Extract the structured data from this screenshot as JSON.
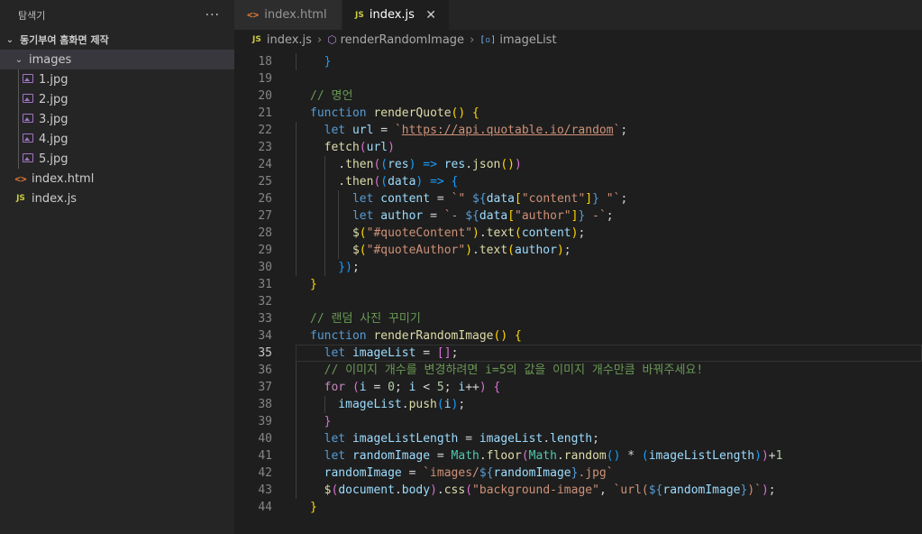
{
  "sidebar": {
    "title": "탐색기",
    "more_label": "···",
    "project_name": "동기부여 홈화면 제작",
    "folder_images": "images",
    "files_images": [
      "1.jpg",
      "2.jpg",
      "3.jpg",
      "4.jpg",
      "5.jpg"
    ],
    "file_html": "index.html",
    "file_js": "index.js"
  },
  "tabs": [
    {
      "label": "index.html",
      "icon": "html-icon",
      "active": false
    },
    {
      "label": "index.js",
      "icon": "js-icon",
      "active": true
    }
  ],
  "tab_close": "✕",
  "icons": {
    "js_label": "JS",
    "html_glyph": "<>"
  },
  "breadcrumb": {
    "file": "index.js",
    "function": "renderRandomImage",
    "symbol": "imageList"
  },
  "editor": {
    "first_line": 18,
    "current_line": 35,
    "lines": [
      [
        [
          "  }",
          "br3"
        ]
      ],
      [],
      [
        [
          "// 명언",
          "cmt"
        ]
      ],
      [
        [
          "function ",
          "kw"
        ],
        [
          "renderQuote",
          "fn"
        ],
        [
          "() {",
          "br1"
        ]
      ],
      [
        [
          "  let ",
          "kw"
        ],
        [
          "url",
          "var"
        ],
        [
          " = ",
          "pun"
        ],
        [
          "`",
          "str"
        ],
        [
          "https://api.quotable.io/random",
          "str url"
        ],
        [
          "`",
          "str"
        ],
        [
          ";",
          "pun"
        ]
      ],
      [
        [
          "  fetch",
          "fn"
        ],
        [
          "(",
          "br2"
        ],
        [
          "url",
          "var"
        ],
        [
          ")",
          "br2"
        ]
      ],
      [
        [
          "    .",
          "pun"
        ],
        [
          "then",
          "fn"
        ],
        [
          "(",
          "br2"
        ],
        [
          "(",
          "br3"
        ],
        [
          "res",
          "var"
        ],
        [
          ") => ",
          "br3"
        ],
        [
          "res",
          "var"
        ],
        [
          ".",
          "pun"
        ],
        [
          "json",
          "fn"
        ],
        [
          "()",
          "br1"
        ],
        [
          ")",
          "br2"
        ]
      ],
      [
        [
          "    .",
          "pun"
        ],
        [
          "then",
          "fn"
        ],
        [
          "(",
          "br2"
        ],
        [
          "(",
          "br3"
        ],
        [
          "data",
          "var"
        ],
        [
          ") => {",
          "br3"
        ]
      ],
      [
        [
          "      let ",
          "kw"
        ],
        [
          "content",
          "var"
        ],
        [
          " = ",
          "pun"
        ],
        [
          "`\" ",
          "str"
        ],
        [
          "${",
          "kw"
        ],
        [
          "data",
          "var"
        ],
        [
          "[",
          "br1"
        ],
        [
          "\"content\"",
          "str"
        ],
        [
          "]",
          "br1"
        ],
        [
          "}",
          "kw"
        ],
        [
          " \"`",
          "str"
        ],
        [
          ";",
          "pun"
        ]
      ],
      [
        [
          "      let ",
          "kw"
        ],
        [
          "author",
          "var"
        ],
        [
          " = ",
          "pun"
        ],
        [
          "`- ",
          "str"
        ],
        [
          "${",
          "kw"
        ],
        [
          "data",
          "var"
        ],
        [
          "[",
          "br1"
        ],
        [
          "\"author\"",
          "str"
        ],
        [
          "]",
          "br1"
        ],
        [
          "}",
          "kw"
        ],
        [
          " -`",
          "str"
        ],
        [
          ";",
          "pun"
        ]
      ],
      [
        [
          "      $",
          "fn"
        ],
        [
          "(",
          "br1"
        ],
        [
          "\"#quoteContent\"",
          "str"
        ],
        [
          ")",
          "br1"
        ],
        [
          ".",
          "pun"
        ],
        [
          "text",
          "fn"
        ],
        [
          "(",
          "br1"
        ],
        [
          "content",
          "var"
        ],
        [
          ")",
          "br1"
        ],
        [
          ";",
          "pun"
        ]
      ],
      [
        [
          "      $",
          "fn"
        ],
        [
          "(",
          "br1"
        ],
        [
          "\"#quoteAuthor\"",
          "str"
        ],
        [
          ")",
          "br1"
        ],
        [
          ".",
          "pun"
        ],
        [
          "text",
          "fn"
        ],
        [
          "(",
          "br1"
        ],
        [
          "author",
          "var"
        ],
        [
          ")",
          "br1"
        ],
        [
          ";",
          "pun"
        ]
      ],
      [
        [
          "    })",
          "br3"
        ],
        [
          ";",
          "pun"
        ]
      ],
      [
        [
          "}",
          "br1"
        ]
      ],
      [],
      [
        [
          "// 랜덤 사진 꾸미기",
          "cmt"
        ]
      ],
      [
        [
          "function ",
          "kw"
        ],
        [
          "renderRandomImage",
          "fn"
        ],
        [
          "() {",
          "br1"
        ]
      ],
      [
        [
          "  let ",
          "kw"
        ],
        [
          "imageList",
          "var"
        ],
        [
          " = ",
          "pun"
        ],
        [
          "[]",
          "br2"
        ],
        [
          ";",
          "pun"
        ]
      ],
      [
        [
          "  // 이미지 개수를 변경하려면 i=5의 값을 이미지 개수만큼 바꿔주세요!",
          "cmt"
        ]
      ],
      [
        [
          "  for ",
          "ctl"
        ],
        [
          "(",
          "br2"
        ],
        [
          "i",
          "var"
        ],
        [
          " = ",
          "pun"
        ],
        [
          "0",
          "num"
        ],
        [
          "; ",
          "pun"
        ],
        [
          "i",
          "var"
        ],
        [
          " < ",
          "pun"
        ],
        [
          "5",
          "num"
        ],
        [
          "; ",
          "pun"
        ],
        [
          "i",
          "var"
        ],
        [
          "++",
          "pun"
        ],
        [
          ") {",
          "br2"
        ]
      ],
      [
        [
          "    imageList",
          "var"
        ],
        [
          ".",
          "pun"
        ],
        [
          "push",
          "fn"
        ],
        [
          "(",
          "br3"
        ],
        [
          "i",
          "var"
        ],
        [
          ")",
          "br3"
        ],
        [
          ";",
          "pun"
        ]
      ],
      [
        [
          "  }",
          "br2"
        ]
      ],
      [
        [
          "  let ",
          "kw"
        ],
        [
          "imageListLength",
          "var"
        ],
        [
          " = ",
          "pun"
        ],
        [
          "imageList",
          "var"
        ],
        [
          ".",
          "pun"
        ],
        [
          "length",
          "var"
        ],
        [
          ";",
          "pun"
        ]
      ],
      [
        [
          "  let ",
          "kw"
        ],
        [
          "randomImage",
          "var"
        ],
        [
          " = ",
          "pun"
        ],
        [
          "Math",
          "cls"
        ],
        [
          ".",
          "pun"
        ],
        [
          "floor",
          "fn"
        ],
        [
          "(",
          "br2"
        ],
        [
          "Math",
          "cls"
        ],
        [
          ".",
          "pun"
        ],
        [
          "random",
          "fn"
        ],
        [
          "()",
          "br3"
        ],
        [
          " * ",
          "pun"
        ],
        [
          "(",
          "br3"
        ],
        [
          "imageListLength",
          "var"
        ],
        [
          ")",
          "br3"
        ],
        [
          ")",
          "br2"
        ],
        [
          "+",
          "pun"
        ],
        [
          "1",
          "num"
        ]
      ],
      [
        [
          "  randomImage",
          "var"
        ],
        [
          " = ",
          "pun"
        ],
        [
          "`images/",
          "str"
        ],
        [
          "${",
          "kw"
        ],
        [
          "randomImage",
          "var"
        ],
        [
          "}",
          "kw"
        ],
        [
          ".jpg`",
          "str"
        ]
      ],
      [
        [
          "  $",
          "fn"
        ],
        [
          "(",
          "br2"
        ],
        [
          "document",
          "var"
        ],
        [
          ".",
          "pun"
        ],
        [
          "body",
          "var"
        ],
        [
          ")",
          "br2"
        ],
        [
          ".",
          "pun"
        ],
        [
          "css",
          "fn"
        ],
        [
          "(",
          "br2"
        ],
        [
          "\"background-image\"",
          "str"
        ],
        [
          ", ",
          "pun"
        ],
        [
          "`url(",
          "str"
        ],
        [
          "${",
          "kw"
        ],
        [
          "randomImage",
          "var"
        ],
        [
          "}",
          "kw"
        ],
        [
          ")`",
          "str"
        ],
        [
          ")",
          "br2"
        ],
        [
          ";",
          "pun"
        ]
      ],
      [
        [
          "}",
          "br1"
        ]
      ]
    ]
  }
}
